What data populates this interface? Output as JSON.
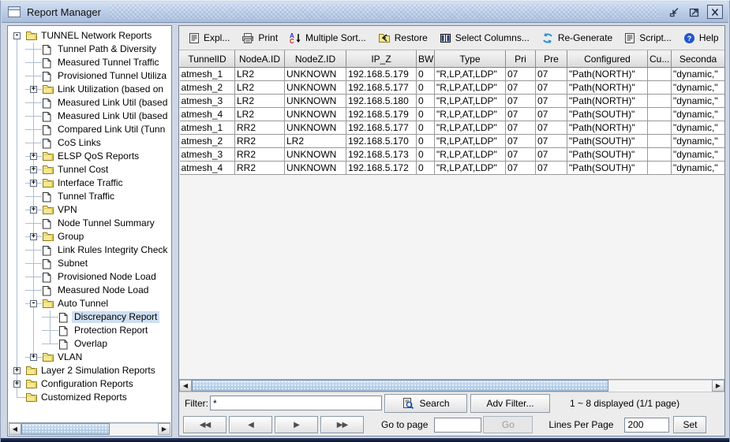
{
  "window": {
    "title": "Report Manager",
    "controls": [
      {
        "name": "iconify-button",
        "icon": "iconify-icon"
      },
      {
        "name": "maximize-button",
        "icon": "maximize-icon"
      },
      {
        "name": "close-button",
        "icon": "close-icon"
      }
    ]
  },
  "toolbar": {
    "buttons": [
      {
        "name": "export-button",
        "icon": "export-icon",
        "label": "Expl..."
      },
      {
        "name": "print-button",
        "icon": "print-icon",
        "label": "Print"
      },
      {
        "name": "multiple-sort-button",
        "icon": "sort-icon",
        "label": "Multiple Sort..."
      },
      {
        "name": "restore-button",
        "icon": "restore-icon",
        "label": "Restore"
      },
      {
        "name": "select-columns-button",
        "icon": "columns-icon",
        "label": "Select Columns..."
      },
      {
        "name": "regenerate-button",
        "icon": "refresh-icon",
        "label": "Re-Generate"
      },
      {
        "name": "script-button",
        "icon": "script-icon",
        "label": "Script..."
      },
      {
        "name": "help-button",
        "icon": "help-icon",
        "label": "Help"
      }
    ]
  },
  "tree": {
    "items": [
      {
        "label": "TUNNEL Network Reports",
        "icon": "folder-icon",
        "depth": 0,
        "expander": "expanded",
        "selected": false
      },
      {
        "label": "Tunnel Path & Diversity",
        "icon": "document-icon",
        "depth": 1,
        "expander": "none",
        "selected": false
      },
      {
        "label": "Measured Tunnel Traffic",
        "icon": "document-icon",
        "depth": 1,
        "expander": "none",
        "selected": false
      },
      {
        "label": "Provisioned Tunnel Utiliza",
        "icon": "document-icon",
        "depth": 1,
        "expander": "none",
        "selected": false
      },
      {
        "label": "Link Utilization (based on",
        "icon": "folder-icon",
        "depth": 1,
        "expander": "collapsed",
        "selected": false
      },
      {
        "label": "Measured Link Util (based",
        "icon": "document-icon",
        "depth": 1,
        "expander": "none",
        "selected": false
      },
      {
        "label": "Measured Link Util (based",
        "icon": "document-icon",
        "depth": 1,
        "expander": "none",
        "selected": false
      },
      {
        "label": "Compared Link Util (Tunn",
        "icon": "document-icon",
        "depth": 1,
        "expander": "none",
        "selected": false
      },
      {
        "label": "CoS Links",
        "icon": "document-icon",
        "depth": 1,
        "expander": "none",
        "selected": false
      },
      {
        "label": "ELSP QoS Reports",
        "icon": "folder-icon",
        "depth": 1,
        "expander": "collapsed",
        "selected": false
      },
      {
        "label": "Tunnel Cost",
        "icon": "folder-icon",
        "depth": 1,
        "expander": "collapsed",
        "selected": false
      },
      {
        "label": "Interface Traffic",
        "icon": "folder-icon",
        "depth": 1,
        "expander": "collapsed",
        "selected": false
      },
      {
        "label": "Tunnel Traffic",
        "icon": "document-icon",
        "depth": 1,
        "expander": "none",
        "selected": false
      },
      {
        "label": "VPN",
        "icon": "folder-icon",
        "depth": 1,
        "expander": "collapsed",
        "selected": false
      },
      {
        "label": "Node Tunnel Summary",
        "icon": "document-icon",
        "depth": 1,
        "expander": "none",
        "selected": false
      },
      {
        "label": "Group",
        "icon": "folder-icon",
        "depth": 1,
        "expander": "collapsed",
        "selected": false
      },
      {
        "label": "Link Rules Integrity Check",
        "icon": "document-icon",
        "depth": 1,
        "expander": "none",
        "selected": false
      },
      {
        "label": "Subnet",
        "icon": "document-icon",
        "depth": 1,
        "expander": "none",
        "selected": false
      },
      {
        "label": "Provisioned Node Load",
        "icon": "document-icon",
        "depth": 1,
        "expander": "none",
        "selected": false
      },
      {
        "label": "Measured Node Load",
        "icon": "document-icon",
        "depth": 1,
        "expander": "none",
        "selected": false
      },
      {
        "label": "Auto Tunnel",
        "icon": "folder-icon",
        "depth": 1,
        "expander": "expanded",
        "selected": false
      },
      {
        "label": "Discrepancy Report",
        "icon": "document-icon",
        "depth": 2,
        "expander": "none",
        "selected": true
      },
      {
        "label": "Protection Report",
        "icon": "document-icon",
        "depth": 2,
        "expander": "none",
        "selected": false
      },
      {
        "label": "Overlap",
        "icon": "document-icon",
        "depth": 2,
        "expander": "none",
        "selected": false
      },
      {
        "label": "VLAN",
        "icon": "folder-icon",
        "depth": 1,
        "expander": "collapsed",
        "selected": false
      },
      {
        "label": "Layer 2 Simulation Reports",
        "icon": "folder-icon",
        "depth": 0,
        "expander": "collapsed",
        "selected": false
      },
      {
        "label": "Configuration Reports",
        "icon": "folder-icon",
        "depth": 0,
        "expander": "collapsed",
        "selected": false
      },
      {
        "label": "Customized Reports",
        "icon": "folder-icon",
        "depth": 0,
        "expander": "none",
        "selected": false
      }
    ]
  },
  "table": {
    "columns": [
      "TunnelID",
      "NodeA.ID",
      "NodeZ.ID",
      "IP_Z",
      "BW",
      "Type",
      "Pri",
      "Pre",
      "Configured",
      "Cu...",
      "Seconda"
    ],
    "rows": [
      [
        "atmesh_1",
        "LR2",
        "UNKNOWN",
        "192.168.5.179",
        "0",
        "\"R,LP,AT,LDP\"",
        "07",
        "07",
        "\"Path(NORTH)\"",
        "",
        "\"dynamic,\""
      ],
      [
        "atmesh_2",
        "LR2",
        "UNKNOWN",
        "192.168.5.177",
        "0",
        "\"R,LP,AT,LDP\"",
        "07",
        "07",
        "\"Path(NORTH)\"",
        "",
        "\"dynamic,\""
      ],
      [
        "atmesh_3",
        "LR2",
        "UNKNOWN",
        "192.168.5.180",
        "0",
        "\"R,LP,AT,LDP\"",
        "07",
        "07",
        "\"Path(NORTH)\"",
        "",
        "\"dynamic,\""
      ],
      [
        "atmesh_4",
        "LR2",
        "UNKNOWN",
        "192.168.5.179",
        "0",
        "\"R,LP,AT,LDP\"",
        "07",
        "07",
        "\"Path(SOUTH)\"",
        "",
        "\"dynamic,\""
      ],
      [
        "atmesh_1",
        "RR2",
        "UNKNOWN",
        "192.168.5.177",
        "0",
        "\"R,LP,AT,LDP\"",
        "07",
        "07",
        "\"Path(NORTH)\"",
        "",
        "\"dynamic,\""
      ],
      [
        "atmesh_2",
        "RR2",
        "LR2",
        "192.168.5.170",
        "0",
        "\"R,LP,AT,LDP\"",
        "07",
        "07",
        "\"Path(SOUTH)\"",
        "",
        "\"dynamic,\""
      ],
      [
        "atmesh_3",
        "RR2",
        "UNKNOWN",
        "192.168.5.173",
        "0",
        "\"R,LP,AT,LDP\"",
        "07",
        "07",
        "\"Path(SOUTH)\"",
        "",
        "\"dynamic,\""
      ],
      [
        "atmesh_4",
        "RR2",
        "UNKNOWN",
        "192.168.5.172",
        "0",
        "\"R,LP,AT,LDP\"",
        "07",
        "07",
        "\"Path(SOUTH)\"",
        "",
        "\"dynamic,\""
      ]
    ]
  },
  "filterbar": {
    "filter_label": "Filter:",
    "filter_value": "*",
    "search_label": "Search",
    "adv_filter_label": "Adv Filter...",
    "status": "1 ~ 8 displayed (1/1 page)"
  },
  "pager": {
    "nav_buttons": [
      {
        "name": "first-page-button",
        "icon": "double-left-arrow-icon",
        "glyph": "◀◀"
      },
      {
        "name": "previous-page-button",
        "icon": "left-arrow-icon",
        "glyph": "◀"
      },
      {
        "name": "next-page-button",
        "icon": "right-arrow-icon",
        "glyph": "▶"
      },
      {
        "name": "last-page-button",
        "icon": "double-right-arrow-icon",
        "glyph": "▶▶"
      }
    ],
    "goto_label": "Go to page",
    "goto_value": "",
    "go_label": "Go",
    "lines_label": "Lines Per Page",
    "lines_value": "200",
    "set_label": "Set"
  },
  "colors": {
    "titlebar": "#b9cbe6",
    "selection": "#cfdff2",
    "scroll_thumb": "#a4c1de",
    "refresh_blue": "#2e8fd0",
    "help_blue": "#2255cc",
    "folder_yellow": "#f6e88f"
  }
}
